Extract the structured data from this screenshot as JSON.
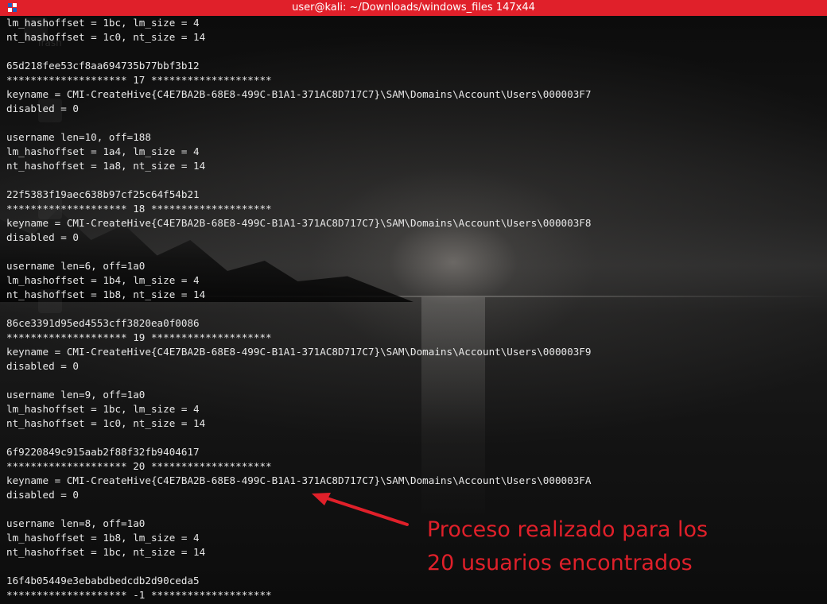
{
  "window": {
    "title": "user@kali: ~/Downloads/windows_files 147x44"
  },
  "desktop": {
    "trash_label": "Trash"
  },
  "terminal": {
    "lines": [
      "lm_hashoffset = 1bc, lm_size = 4",
      "nt_hashoffset = 1c0, nt_size = 14",
      "",
      "65d218fee53cf8aa694735b77bbf3b12",
      "******************** 17 ********************",
      "keyname = CMI-CreateHive{C4E7BA2B-68E8-499C-B1A1-371AC8D717C7}\\SAM\\Domains\\Account\\Users\\000003F7",
      "disabled = 0",
      "",
      "username len=10, off=188",
      "lm_hashoffset = 1a4, lm_size = 4",
      "nt_hashoffset = 1a8, nt_size = 14",
      "",
      "22f5383f19aec638b97cf25c64f54b21",
      "******************** 18 ********************",
      "keyname = CMI-CreateHive{C4E7BA2B-68E8-499C-B1A1-371AC8D717C7}\\SAM\\Domains\\Account\\Users\\000003F8",
      "disabled = 0",
      "",
      "username len=6, off=1a0",
      "lm_hashoffset = 1b4, lm_size = 4",
      "nt_hashoffset = 1b8, nt_size = 14",
      "",
      "86ce3391d95ed4553cff3820ea0f0086",
      "******************** 19 ********************",
      "keyname = CMI-CreateHive{C4E7BA2B-68E8-499C-B1A1-371AC8D717C7}\\SAM\\Domains\\Account\\Users\\000003F9",
      "disabled = 0",
      "",
      "username len=9, off=1a0",
      "lm_hashoffset = 1bc, lm_size = 4",
      "nt_hashoffset = 1c0, nt_size = 14",
      "",
      "6f9220849c915aab2f88f32fb9404617",
      "******************** 20 ********************",
      "keyname = CMI-CreateHive{C4E7BA2B-68E8-499C-B1A1-371AC8D717C7}\\SAM\\Domains\\Account\\Users\\000003FA",
      "disabled = 0",
      "",
      "username len=8, off=1a0",
      "lm_hashoffset = 1b8, lm_size = 4",
      "nt_hashoffset = 1bc, nt_size = 14",
      "",
      "16f4b05449e3ebabdbedcdb2d90ceda5",
      "******************** -1 ********************"
    ]
  },
  "annotation": {
    "line1": "Proceso realizado para los",
    "line2": "20 usuarios encontrados",
    "color": "#e0202a"
  },
  "colors": {
    "titlebar": "#e0202a",
    "terminal_text": "#e8e8e8"
  },
  "icons": {
    "app": "terminal-app-icon"
  }
}
